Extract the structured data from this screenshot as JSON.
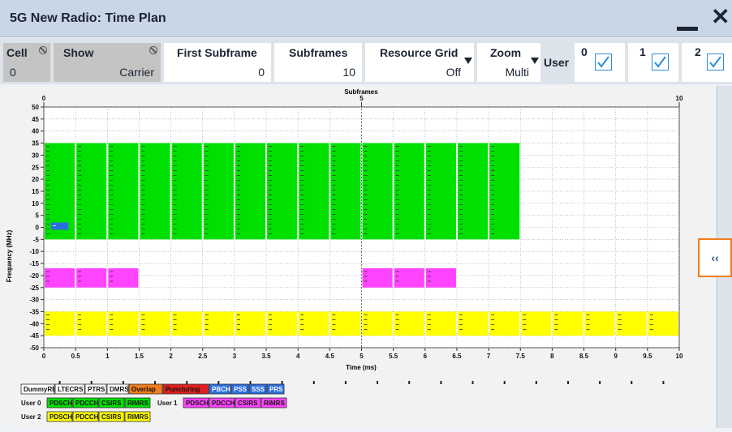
{
  "window": {
    "title": "5G New Radio: Time Plan"
  },
  "toolbar": {
    "cell": {
      "label": "Cell",
      "value": "0"
    },
    "show": {
      "label": "Show",
      "value": "Carrier"
    },
    "first_subframe": {
      "label": "First Subframe",
      "value": "0"
    },
    "subframes": {
      "label": "Subframes",
      "value": "10"
    },
    "resource_grid": {
      "label": "Resource Grid",
      "value": "Off"
    },
    "zoom": {
      "label": "Zoom",
      "value": "Multi"
    },
    "user_label": "User",
    "users": [
      {
        "num": "0",
        "checked": true
      },
      {
        "num": "1",
        "checked": true
      },
      {
        "num": "2",
        "checked": true
      }
    ]
  },
  "expand_label": "‹‹",
  "chart_data": {
    "type": "timeplan",
    "top_axis": {
      "label": "Subframes",
      "ticks": [
        "0",
        "5",
        "10"
      ]
    },
    "xlabel": "Time (ms)",
    "ylabel": "Frequency (MHz)",
    "xlim": [
      0,
      10
    ],
    "ylim": [
      -50,
      50
    ],
    "x_ticks": [
      "0",
      "0.5",
      "1",
      "1.5",
      "2",
      "2.5",
      "3",
      "3.5",
      "4",
      "4.5",
      "5",
      "5.5",
      "6",
      "6.5",
      "7",
      "7.5",
      "8",
      "8.5",
      "9",
      "9.5",
      "10"
    ],
    "y_ticks": [
      "50",
      "45",
      "40",
      "35",
      "30",
      "25",
      "20",
      "15",
      "10",
      "5",
      "0",
      "-5",
      "-10",
      "-15",
      "-20",
      "-25",
      "-30",
      "-35",
      "-40",
      "-45",
      "-50"
    ],
    "regions": [
      {
        "user": "User 0",
        "color": "#00e000",
        "f_lo": -5,
        "f_hi": 35,
        "segments": [
          [
            0,
            0.5
          ],
          [
            0.5,
            1
          ],
          [
            1,
            1.5
          ],
          [
            1.5,
            2
          ],
          [
            2,
            2.5
          ],
          [
            2.5,
            3
          ],
          [
            3,
            3.5
          ],
          [
            3.5,
            4
          ],
          [
            4,
            4.5
          ],
          [
            4.5,
            5
          ],
          [
            5,
            5.5
          ],
          [
            5.5,
            6
          ],
          [
            6,
            6.5
          ],
          [
            6.5,
            7
          ],
          [
            7,
            7.5
          ]
        ]
      },
      {
        "user": "User 0",
        "color": "#2a6fe0",
        "f_lo": -1,
        "f_hi": 2,
        "segments": [
          [
            0.1,
            0.4
          ]
        ]
      },
      {
        "user": "User 1",
        "color": "#ff44ff",
        "f_lo": -25,
        "f_hi": -17,
        "segments": [
          [
            0,
            0.5
          ],
          [
            0.5,
            1
          ],
          [
            1,
            1.5
          ],
          [
            5,
            5.5
          ],
          [
            5.5,
            6
          ],
          [
            6,
            6.5
          ]
        ]
      },
      {
        "user": "User 2",
        "color": "#ffff00",
        "f_lo": -45,
        "f_hi": -35,
        "segments": [
          [
            0,
            0.5
          ],
          [
            0.5,
            1
          ],
          [
            1,
            1.5
          ],
          [
            1.5,
            2
          ],
          [
            2,
            2.5
          ],
          [
            2.5,
            3
          ],
          [
            3,
            3.5
          ],
          [
            3.5,
            4
          ],
          [
            4,
            4.5
          ],
          [
            4.5,
            5
          ],
          [
            5,
            5.5
          ],
          [
            5.5,
            6
          ],
          [
            6,
            6.5
          ],
          [
            6.5,
            7
          ],
          [
            7,
            7.5
          ],
          [
            7.5,
            8
          ],
          [
            8,
            8.5
          ],
          [
            8.5,
            9
          ],
          [
            9,
            9.5
          ],
          [
            9.5,
            10
          ]
        ]
      }
    ],
    "legend": {
      "common": [
        {
          "label": "DummyRE",
          "color": "#ffffff"
        },
        {
          "label": "LTECRS",
          "color": "#ffffff"
        },
        {
          "label": "PTRS",
          "color": "#ffffff"
        },
        {
          "label": "DMRS",
          "color": "#ffffff"
        },
        {
          "label": "Overlap",
          "color": "#f07d1a"
        },
        {
          "label": "Puncturing",
          "color": "#e02020"
        },
        {
          "label": "PBCH",
          "color": "#2a6fe0"
        },
        {
          "label": "PSS",
          "color": "#2a6fe0"
        },
        {
          "label": "SSS",
          "color": "#2a6fe0"
        },
        {
          "label": "PRS",
          "color": "#2a6fe0"
        }
      ],
      "user0": {
        "label": "User 0",
        "items": [
          "PDSCH",
          "PDCCH",
          "CSIRS",
          "RIMRS"
        ],
        "color": "#00e000"
      },
      "user1": {
        "label": "User 1",
        "items": [
          "PDSCH",
          "PDCCH",
          "CSIRS",
          "RIMRS"
        ],
        "color": "#ff44ff"
      },
      "user2": {
        "label": "User 2",
        "items": [
          "PDSCH",
          "PDCCH",
          "CSIRS",
          "RIMRS"
        ],
        "color": "#ffff00"
      }
    }
  }
}
